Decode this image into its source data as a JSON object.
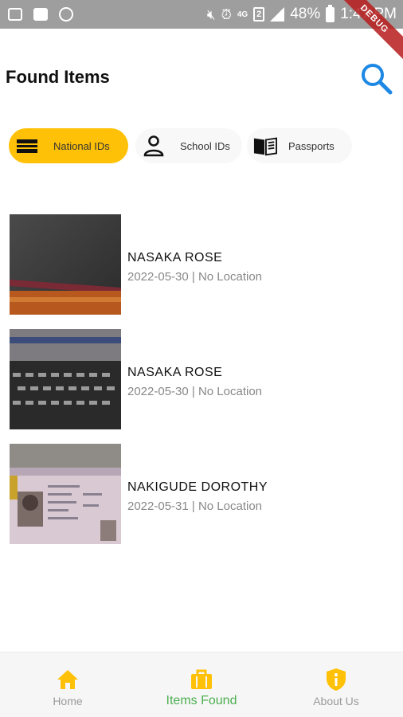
{
  "status_bar": {
    "network": "4G",
    "sim": "2",
    "battery": "48%",
    "time": "1:47 PM"
  },
  "debug_banner": "DEBUG",
  "header": {
    "title": "Found Items",
    "search_icon": "search-icon"
  },
  "categories": [
    {
      "label": "National IDs",
      "icon": "id-card-icon",
      "active": true
    },
    {
      "label": "School IDs",
      "icon": "person-icon",
      "active": false
    },
    {
      "label": "Passports",
      "icon": "book-icon",
      "active": false
    }
  ],
  "items": [
    {
      "name": "NASAKA ROSE",
      "meta": "2022-05-30 | No Location"
    },
    {
      "name": "NASAKA ROSE",
      "meta": "2022-05-30 | No Location"
    },
    {
      "name": "NAKIGUDE DOROTHY",
      "meta": "2022-05-31 | No Location"
    }
  ],
  "bottom_nav": [
    {
      "label": "Home",
      "icon": "home-icon",
      "active": false
    },
    {
      "label": "Items Found",
      "icon": "briefcase-icon",
      "active": true
    },
    {
      "label": "About Us",
      "icon": "shield-info-icon",
      "active": false
    }
  ],
  "colors": {
    "accent": "#ffc107",
    "search": "#1e88e5",
    "active_nav": "#4caf50",
    "inactive_nav": "#9a9a9a"
  }
}
